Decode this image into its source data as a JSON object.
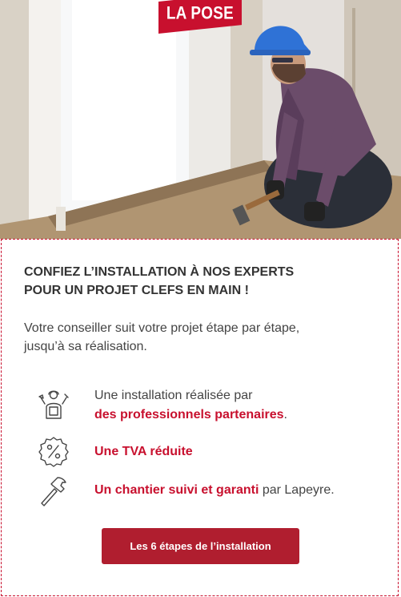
{
  "badge": {
    "label": "LA POSE"
  },
  "headline": {
    "line1": "CONFIEZ L’INSTALLATION À NOS EXPERTS",
    "line2": "POUR UN PROJET CLEFS EN MAIN !"
  },
  "intro": {
    "line1": "Votre conseiller suit votre projet étape par étape,",
    "line2": "jusqu’à sa réalisation."
  },
  "features": [
    {
      "icon": "worker-icon",
      "prefix": "Une installation réalisée par",
      "highlight": "des professionnels partenaires",
      "suffix": "."
    },
    {
      "icon": "percent-badge-icon",
      "prefix": "",
      "highlight": "Une TVA réduite",
      "suffix": ""
    },
    {
      "icon": "hammer-icon",
      "prefix": "",
      "highlight": "Un chantier suivi et garanti",
      "suffix": " par Lapeyre."
    }
  ],
  "cta": {
    "label": "Les 6 étapes de l’installation"
  },
  "colors": {
    "brand_red": "#c8102e",
    "button_red": "#b01e2f",
    "text": "#444444"
  }
}
